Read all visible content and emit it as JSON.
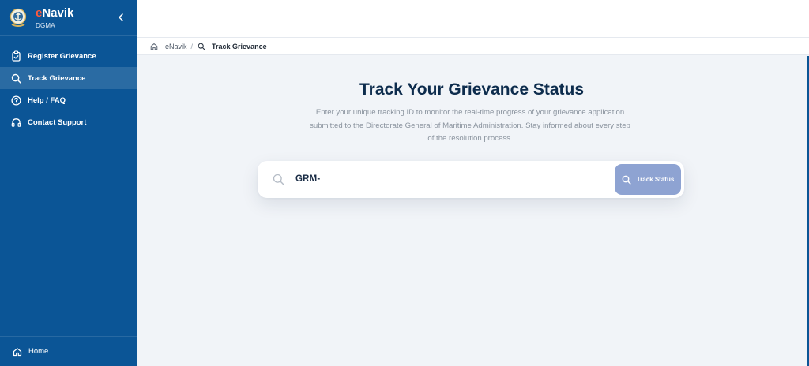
{
  "app": {
    "brand_prefix": "e",
    "brand_rest": "Navik",
    "brand_sub": "DGMA"
  },
  "sidebar": {
    "items": [
      {
        "label": "Register Grievance",
        "icon": "clipboard-check-icon",
        "active": false
      },
      {
        "label": "Track Grievance",
        "icon": "search-icon",
        "active": true
      },
      {
        "label": "Help / FAQ",
        "icon": "help-circle-icon",
        "active": false
      },
      {
        "label": "Contact Support",
        "icon": "headphones-icon",
        "active": false
      }
    ],
    "footer_label": "Home"
  },
  "breadcrumb": {
    "root": "eNavik",
    "separator": "/",
    "current": "Track Grievance"
  },
  "main": {
    "title": "Track Your Grievance Status",
    "description": "Enter your unique tracking ID to monitor the real-time progress of your grievance application submitted to the Directorate General of Maritime Administration. Stay informed about every step of the resolution process.",
    "search": {
      "value": "GRM-",
      "button_label": "Track Status"
    }
  },
  "colors": {
    "sidebar_bg": "#0b5596",
    "brand_accent": "#ff5a3c",
    "title": "#0d2c4d",
    "button_bg": "#8ea3d2",
    "page_bg": "#f1f4f8"
  }
}
